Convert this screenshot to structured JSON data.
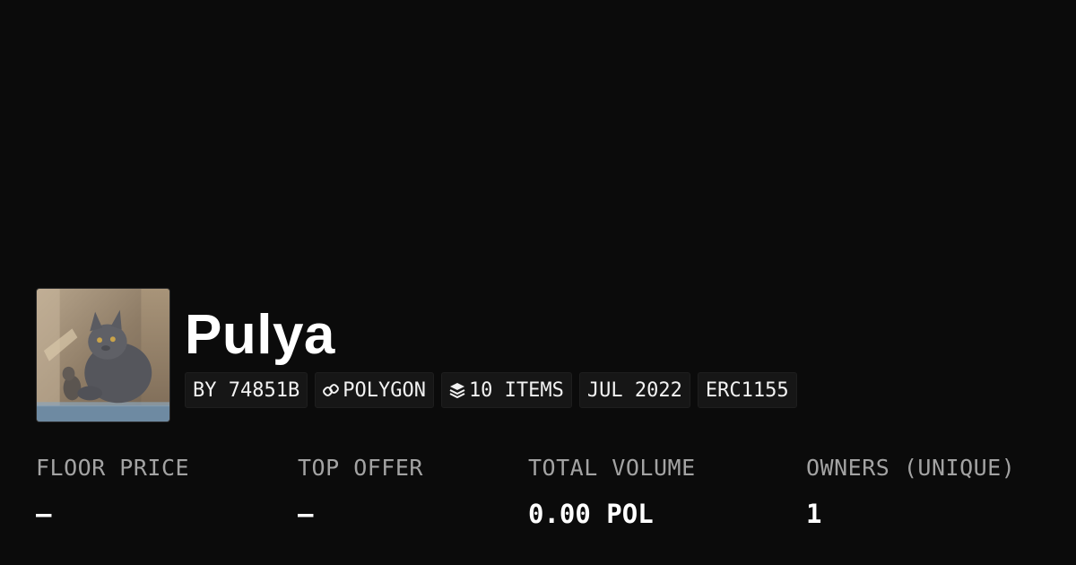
{
  "collection": {
    "name": "Pulya",
    "avatar_alt": "cat",
    "chips": [
      {
        "label": "BY 74851B",
        "icon": ""
      },
      {
        "label": "POLYGON",
        "icon": "chain-link-icon"
      },
      {
        "label": "10 ITEMS",
        "icon": "layers-icon"
      },
      {
        "label": "JUL 2022",
        "icon": ""
      },
      {
        "label": "ERC1155",
        "icon": ""
      }
    ]
  },
  "stats": [
    {
      "label": "FLOOR PRICE",
      "value": "–"
    },
    {
      "label": "TOP OFFER",
      "value": "–"
    },
    {
      "label": "TOTAL VOLUME",
      "value": "0.00 POL"
    },
    {
      "label": "OWNERS (UNIQUE)",
      "value": "1"
    }
  ],
  "colors": {
    "background": "#0b0b0b",
    "chip_background": "#161616",
    "label": "#a3a3a3",
    "text": "#ffffff"
  }
}
